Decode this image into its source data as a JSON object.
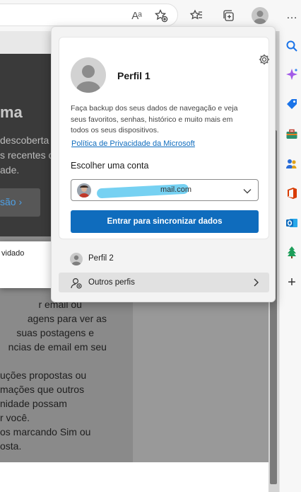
{
  "toolbar": {
    "read_aloud_glyph": "Aᵃ",
    "icons": [
      "read-aloud-icon",
      "favorite-add-icon",
      "favorites-icon",
      "collections-icon",
      "profile-icon",
      "more-icon"
    ],
    "more_glyph": "…"
  },
  "background_page": {
    "hero_title": "ma",
    "hero_text": "descoberta\ns recentes c\nade.",
    "hero_button": "são ›",
    "popup_text": "vidado",
    "content_text": "              r email ou\n          agens para ver as\n      suas postagens e\n   ncias de email em seu\n\nuções propostas ou\nmações que outros\nnidade possam\nr você.\nos marcando Sim ou\nosta."
  },
  "sidebar": {
    "icons": [
      "search-icon",
      "copilot-icon",
      "tag-icon",
      "toolbox-icon",
      "people-icon",
      "office-icon",
      "outlook-icon",
      "tree-icon",
      "add-icon"
    ],
    "add_glyph": "+"
  },
  "flyout": {
    "profile_name": "Perfil 1",
    "backup_text": "Faça backup dos seus dados de navegação e veja\nseus favoritos, senhas, histórico e muito mais em\ntodos os seus dispositivos.",
    "privacy_link": "Política de Privacidade da Microsoft",
    "choose_account_label": "Escolher uma conta",
    "account_email_visible": "mail.com",
    "sync_button": "Entrar para sincronizar dados",
    "other_profile": "Perfil 2",
    "other_profiles": "Outros perfis"
  },
  "colors": {
    "accent": "#0f6cbd",
    "redaction": "#5ec9f0",
    "flyout_bg": "#f3f3f3"
  }
}
